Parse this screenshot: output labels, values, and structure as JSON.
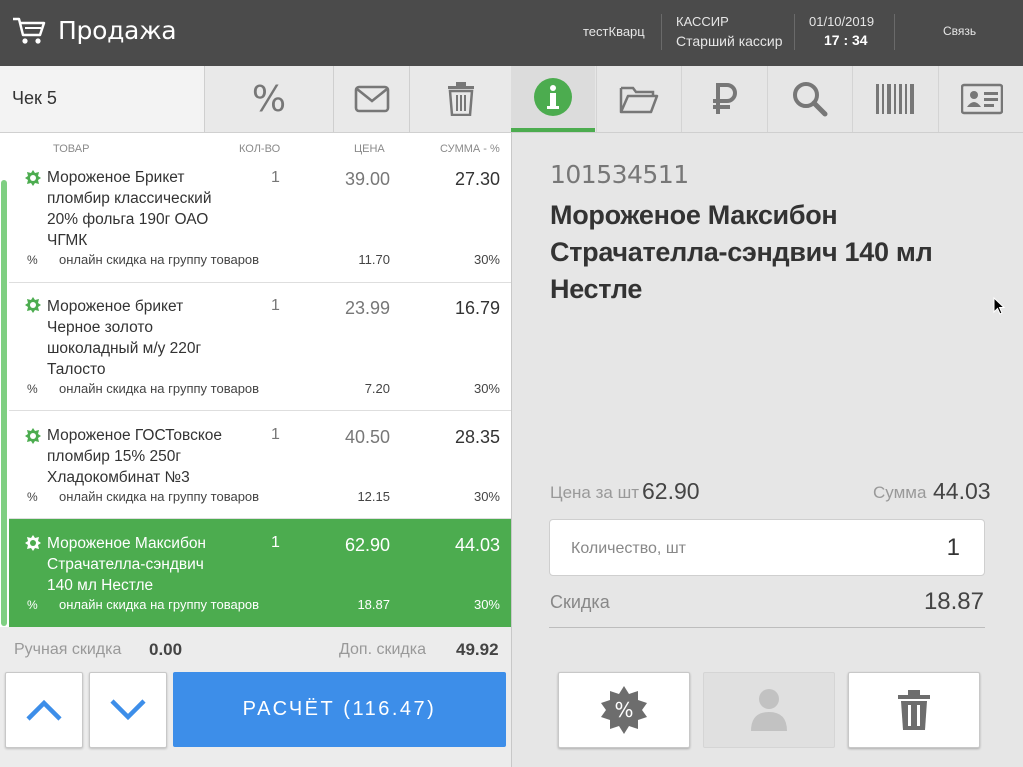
{
  "header": {
    "title": "Продажа",
    "shop": "тестКварц",
    "role_label": "КАССИР",
    "role_value": "Старший кассир",
    "date": "01/10/2019",
    "time": "17 : 34",
    "link": "Связь"
  },
  "receipt": {
    "label": "Чек 5"
  },
  "columns": {
    "item": "ТОВАР",
    "qty": "КОЛ-ВО",
    "price": "ЦЕНА",
    "sum": "СУММА - %"
  },
  "items": [
    {
      "name_lines": [
        "Мороженое Брикет",
        "пломбир классический",
        "20% фольга 190г ОАО",
        "ЧГМК"
      ],
      "qty": "1",
      "price": "39.00",
      "sum": "27.30",
      "discount_sign": "%",
      "discount_label": "онлайн скидка на группу товаров",
      "discount_value": "11.70",
      "discount_pct": "30%"
    },
    {
      "name_lines": [
        "Мороженое брикет",
        "Черное золото",
        "шоколадный м/у 220г",
        "Талосто"
      ],
      "qty": "1",
      "price": "23.99",
      "sum": "16.79",
      "discount_sign": "%",
      "discount_label": "онлайн скидка на группу товаров",
      "discount_value": "7.20",
      "discount_pct": "30%"
    },
    {
      "name_lines": [
        "Мороженое ГОСТовское",
        "пломбир 15% 250г",
        "Хладокомбинат №3"
      ],
      "qty": "1",
      "price": "40.50",
      "sum": "28.35",
      "discount_sign": "%",
      "discount_label": "онлайн скидка на группу товаров",
      "discount_value": "12.15",
      "discount_pct": "30%"
    },
    {
      "name_lines": [
        "Мороженое Максибон",
        "Страчателла-сэндвич",
        "140 мл Нестле"
      ],
      "qty": "1",
      "price": "62.90",
      "sum": "44.03",
      "discount_sign": "%",
      "discount_label": "онлайн скидка на группу товаров",
      "discount_value": "18.87",
      "discount_pct": "30%",
      "selected": true
    }
  ],
  "footer": {
    "manual_label": "Ручная скидка",
    "manual_value": "0.00",
    "extra_label": "Доп. скидка",
    "extra_value": "49.92",
    "pay_label": "РАСЧЁТ (116.47)"
  },
  "detail": {
    "code": "101534511",
    "name_lines": [
      "Мороженое Максибон",
      "Страчателла-сэндвич 140 мл",
      "Нестле"
    ],
    "unit_price_label": "Цена за шт",
    "unit_price": "62.90",
    "sum_label": "Сумма",
    "sum": "44.03",
    "qty_placeholder": "Количество, шт",
    "qty_value": "1",
    "discount_label": "Скидка",
    "discount_value": "18.87"
  },
  "colors": {
    "header_bg": "#4b4b4b",
    "accent_green": "#4cac4f",
    "pay_blue": "#3d8ee9"
  },
  "icons": {
    "cart": "cart-icon",
    "percent": "percent-icon",
    "mail": "mail-icon",
    "trash": "trash-icon",
    "info": "info-icon",
    "folder": "folder-icon",
    "ruble": "ruble-icon",
    "search": "search-icon",
    "barcode": "barcode-icon",
    "idcard": "id-card-icon"
  }
}
